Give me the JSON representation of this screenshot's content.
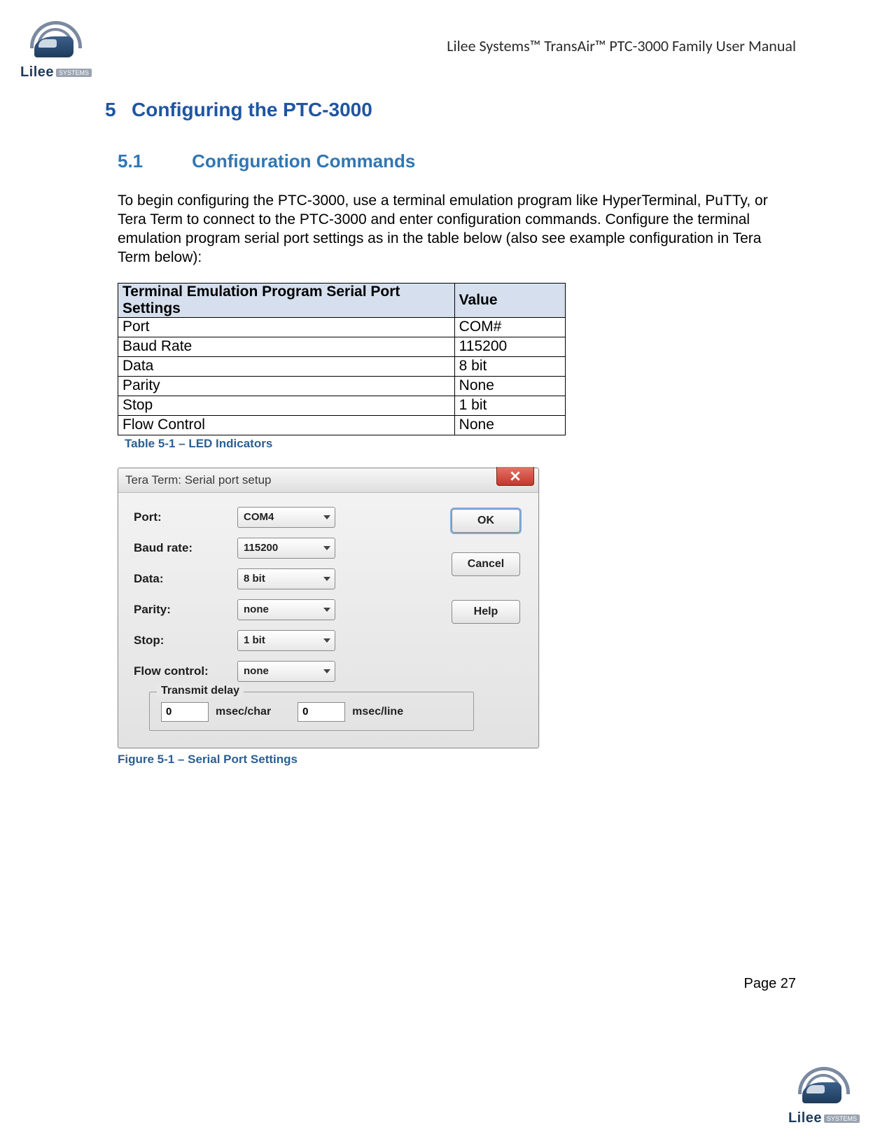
{
  "header": {
    "doc_title": "Lilee Systems™ TransAir™ PTC-3000 Family User Manual",
    "logo_text": "Lilee",
    "logo_badge": "SYSTEMS"
  },
  "section": {
    "num": "5",
    "title": "Configuring the PTC-3000",
    "sub_num": "5.1",
    "sub_title": "Configuration Commands",
    "intro": "To begin configuring the PTC-3000, use a terminal emulation program like HyperTerminal, PuTTy, or Tera Term to connect to the PTC-3000 and enter configuration commands. Configure the terminal emulation program serial port settings as in the table below (also see example configuration in Tera Term below):"
  },
  "table": {
    "head_setting": "Terminal Emulation Program Serial Port Settings",
    "head_value": "Value",
    "rows": [
      {
        "s": "Port",
        "v": "COM#"
      },
      {
        "s": "Baud Rate",
        "v": "115200"
      },
      {
        "s": "Data",
        "v": "8 bit"
      },
      {
        "s": "Parity",
        "v": "None"
      },
      {
        "s": "Stop",
        "v": "1 bit"
      },
      {
        "s": "Flow Control",
        "v": "None"
      }
    ],
    "caption": "Table 5-1  – LED Indicators"
  },
  "dialog": {
    "title": "Tera Term: Serial port setup",
    "fields": {
      "port_label": "Port:",
      "port_value": "COM4",
      "baud_label": "Baud rate:",
      "baud_value": "115200",
      "data_label": "Data:",
      "data_value": "8 bit",
      "parity_label": "Parity:",
      "parity_value": "none",
      "stop_label": "Stop:",
      "stop_value": "1 bit",
      "flow_label": "Flow control:",
      "flow_value": "none"
    },
    "buttons": {
      "ok": "OK",
      "cancel": "Cancel",
      "help": "Help"
    },
    "transmit": {
      "legend": "Transmit delay",
      "char_value": "0",
      "char_unit": "msec/char",
      "line_value": "0",
      "line_unit": "msec/line"
    }
  },
  "figure_caption": "Figure 5-1 – Serial Port Settings",
  "footer": {
    "page": "Page 27"
  }
}
